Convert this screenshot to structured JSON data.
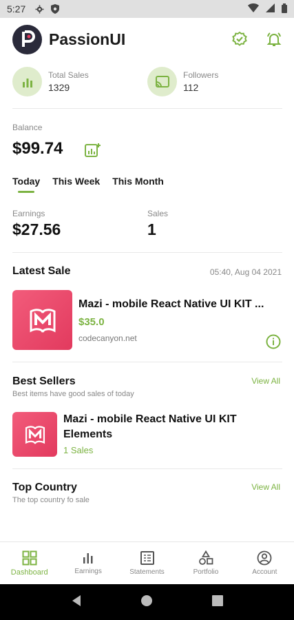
{
  "status_bar": {
    "time": "5:27"
  },
  "header": {
    "app_name": "PassionUI"
  },
  "stats": {
    "total_sales_label": "Total Sales",
    "total_sales_value": "1329",
    "followers_label": "Followers",
    "followers_value": "112"
  },
  "balance": {
    "label": "Balance",
    "amount": "$99.74"
  },
  "period_tabs": [
    "Today",
    "This Week",
    "This Month"
  ],
  "active_tab": "Today",
  "summary": {
    "earnings_label": "Earnings",
    "earnings_value": "$27.56",
    "sales_label": "Sales",
    "sales_value": "1"
  },
  "latest_sale": {
    "title": "Latest Sale",
    "timestamp": "05:40, Aug 04 2021",
    "product_name": "Mazi - mobile React Native UI KIT ...",
    "price": "$35.0",
    "source": "codecanyon.net"
  },
  "best_sellers": {
    "title": "Best Sellers",
    "subtitle": "Best items have good sales of today",
    "view_all": "View All",
    "item_name_line1": "Mazi - mobile React Native UI KIT",
    "item_name_line2": "Elements",
    "item_sales": "1 Sales"
  },
  "top_country": {
    "title": "Top Country",
    "subtitle": "The top country fo sale",
    "view_all": "View All"
  },
  "bottom_nav": {
    "items": [
      "Dashboard",
      "Earnings",
      "Statements",
      "Portfolio",
      "Account"
    ]
  },
  "colors": {
    "accent": "#7cb342",
    "accent_light": "#dfeccc",
    "thumb": "#ee4d6f"
  }
}
